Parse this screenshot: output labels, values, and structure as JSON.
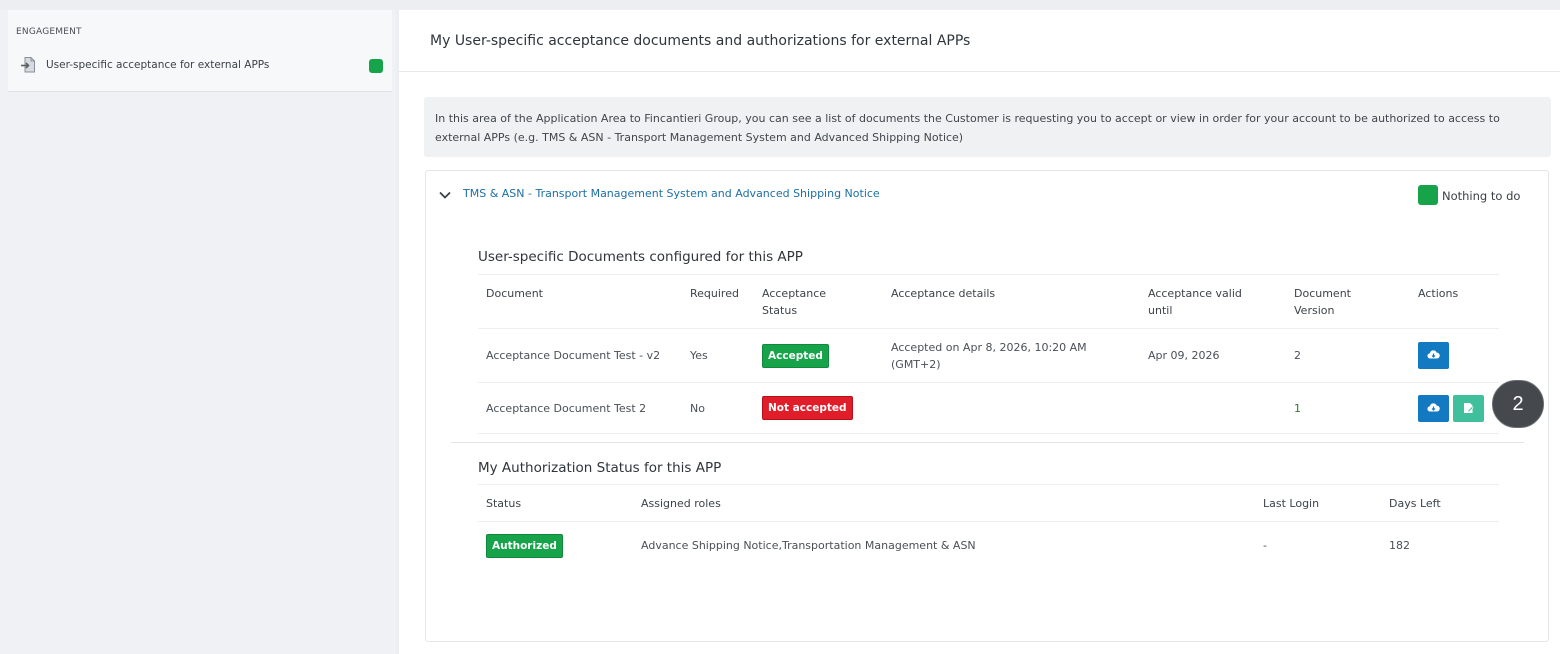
{
  "sidebar": {
    "heading": "ENGAGEMENT",
    "items": [
      {
        "label": "User-specific acceptance for external APPs",
        "icon": "document-import-icon",
        "status_color": "#16a34a"
      }
    ]
  },
  "main": {
    "title": "My User-specific acceptance documents and authorizations for external APPs",
    "intro": "In this area of the Application Area to Fincantieri Group, you can see a list of documents the Customer is requesting you to accept or view in order for your account to be authorized to access to external APPs (e.g. TMS & ASN - Transport Management System and Advanced Shipping Notice)",
    "app": {
      "name": "TMS & ASN - Transport Management System and Advanced Shipping Notice",
      "status_label": "Nothing to do",
      "status_color": "#16a34a",
      "documents_section": {
        "title": "User-specific Documents configured for this APP",
        "columns": {
          "document": "Document",
          "required": "Required",
          "acceptance_status": "Acceptance Status",
          "acceptance_details": "Acceptance details",
          "valid_until": "Acceptance valid until",
          "version": "Document Version",
          "actions": "Actions"
        },
        "rows": [
          {
            "document": "Acceptance Document Test - v2",
            "required": "Yes",
            "status": "Accepted",
            "details": "Accepted on Apr 8, 2026, 10:20 AM (GMT+2)",
            "valid_until": "Apr 09, 2026",
            "version": "2"
          },
          {
            "document": "Acceptance Document Test 2",
            "required": "No",
            "status": "Not accepted",
            "details": "",
            "valid_until": "",
            "version": "1"
          }
        ]
      },
      "authorization_section": {
        "title": "My Authorization Status for this APP",
        "columns": {
          "status": "Status",
          "roles": "Assigned roles",
          "last_login": "Last Login",
          "days_left": "Days Left"
        },
        "row": {
          "status": "Authorized",
          "roles": "Advance Shipping Notice,Transportation Management & ASN",
          "last_login": "-",
          "days_left": "182"
        }
      }
    }
  },
  "overlay": {
    "step_number": "2"
  },
  "colors": {
    "accent_blue": "#1379c0",
    "accent_teal": "#3fbf9b",
    "success": "#16a34a",
    "danger": "#e11d2a",
    "link": "#1d6fa5"
  }
}
